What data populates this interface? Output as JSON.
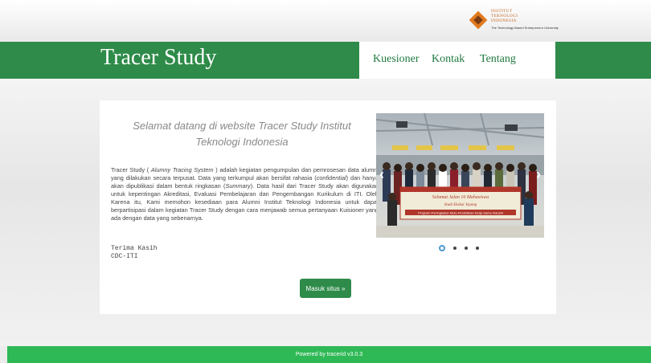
{
  "header": {
    "logo_lines": [
      "INSTITUT",
      "TEKNOLOGI",
      "INDONESIA"
    ],
    "logo_tagline": "The Technology Based Entrepreneur University",
    "brand": "Tracer Study"
  },
  "nav": {
    "items": [
      "Kuesioner",
      "Kontak",
      "Tentang"
    ]
  },
  "main": {
    "welcome": "Selamat datang di website Tracer Study Institut Teknologi Indonesia",
    "description_parts": [
      "Tracer Study ( ",
      "Alumny Tracing System",
      " ) adalah kegiatan pengumpulan dan pemrosesan data alumni yang dilakukan secara terpusat. Data yang terkumpul akan bersifat rahasia (",
      "confidential",
      ") dan hanya akan dipublikasi dalam bentuk ringkasan (",
      "Summary",
      "). Data hasil dari Tracer Study akan digunakan untuk kepentingan Akreditasi, Evaluasi Pembelajaran dan Pengembangan Kurikulum di ITI. Oleh Karena itu, Kami memohon kesediaan para Alumni Institut Teknologi Indonesia untuk dapat berpartisipasi dalam kegiatan Tracer Study dengan cara menjawab semua pertanyaan Kuisioner yang ada dengan data yang sebenarnya."
    ],
    "thanks_1": "Terima Kasih",
    "thanks_2": "CDC-ITI",
    "button": "Masuk situs »"
  },
  "carousel": {
    "prev_icon": "‹",
    "next_icon": "›",
    "banner_lines": [
      "Selamat Jalan 16 Mahasiswa",
      "Studi Ekskul Jepang",
      "Program Peningkatan Mutu Pendidikan Kerja Sama Industri"
    ],
    "dot_count": 4,
    "active_index": 0
  },
  "footer": {
    "text": "Powered by tracerid v3.0.3"
  }
}
